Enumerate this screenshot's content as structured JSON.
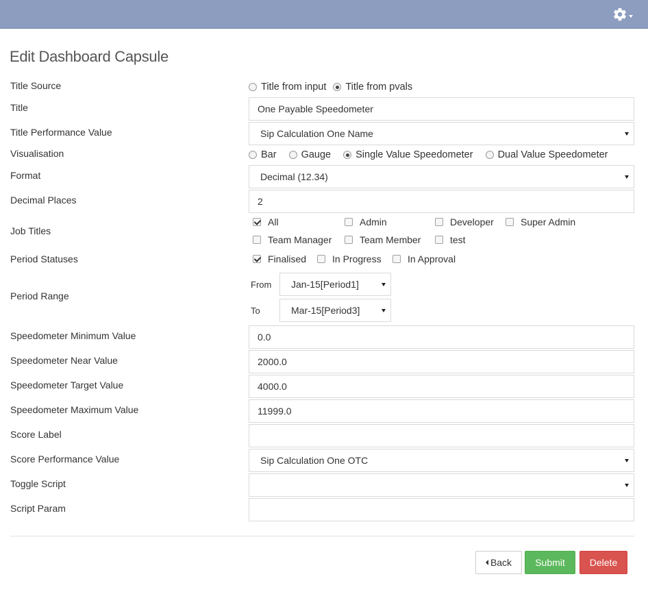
{
  "page_title": "Edit Dashboard Capsule",
  "icons": {
    "settings": "gear-icon"
  },
  "colors": {
    "topbar": "#8c9dc0",
    "submit": "#5cb85c",
    "delete": "#d9534f"
  },
  "labels": {
    "title_source": "Title Source",
    "title": "Title",
    "title_pv": "Title Performance Value",
    "visualisation": "Visualisation",
    "format": "Format",
    "decimal_places": "Decimal Places",
    "job_titles": "Job Titles",
    "period_statuses": "Period Statuses",
    "period_range": "Period Range",
    "speedo_min": "Speedometer Minimum Value",
    "speedo_near": "Speedometer Near Value",
    "speedo_target": "Speedometer Target Value",
    "speedo_max": "Speedometer Maximum Value",
    "score_label": "Score Label",
    "score_pv": "Score Performance Value",
    "toggle_script": "Toggle Script",
    "script_param": "Script Param"
  },
  "title_source": {
    "options": [
      {
        "label": "Title from input",
        "selected": false
      },
      {
        "label": "Title from pvals",
        "selected": true
      }
    ]
  },
  "fields": {
    "title": "One Payable Speedometer",
    "title_pv": "Sip Calculation One Name",
    "format": "Decimal (12.34)",
    "decimal_places": "2",
    "speedo_min": "0.0",
    "speedo_near": "2000.0",
    "speedo_target": "4000.0",
    "speedo_max": "11999.0",
    "score_label": "",
    "score_pv": "Sip Calculation One OTC",
    "toggle_script": "",
    "script_param": ""
  },
  "visualisation": {
    "options": [
      {
        "label": "Bar",
        "selected": false
      },
      {
        "label": "Gauge",
        "selected": false
      },
      {
        "label": "Single Value Speedometer",
        "selected": true
      },
      {
        "label": "Dual Value Speedometer",
        "selected": false
      }
    ]
  },
  "job_titles": [
    {
      "label": "All",
      "checked": true
    },
    {
      "label": "Admin",
      "checked": false
    },
    {
      "label": "Developer",
      "checked": false
    },
    {
      "label": "Super Admin",
      "checked": false
    },
    {
      "label": "Team Manager",
      "checked": false
    },
    {
      "label": "Team Member",
      "checked": false
    },
    {
      "label": "test",
      "checked": false
    }
  ],
  "period_statuses": [
    {
      "label": "Finalised",
      "checked": true
    },
    {
      "label": "In Progress",
      "checked": false
    },
    {
      "label": "In Approval",
      "checked": false
    }
  ],
  "period_range": {
    "from_label": "From",
    "from_value": "Jan-15[Period1]",
    "to_label": "To",
    "to_value": "Mar-15[Period3]"
  },
  "buttons": {
    "back": "Back",
    "submit": "Submit",
    "delete": "Delete"
  }
}
